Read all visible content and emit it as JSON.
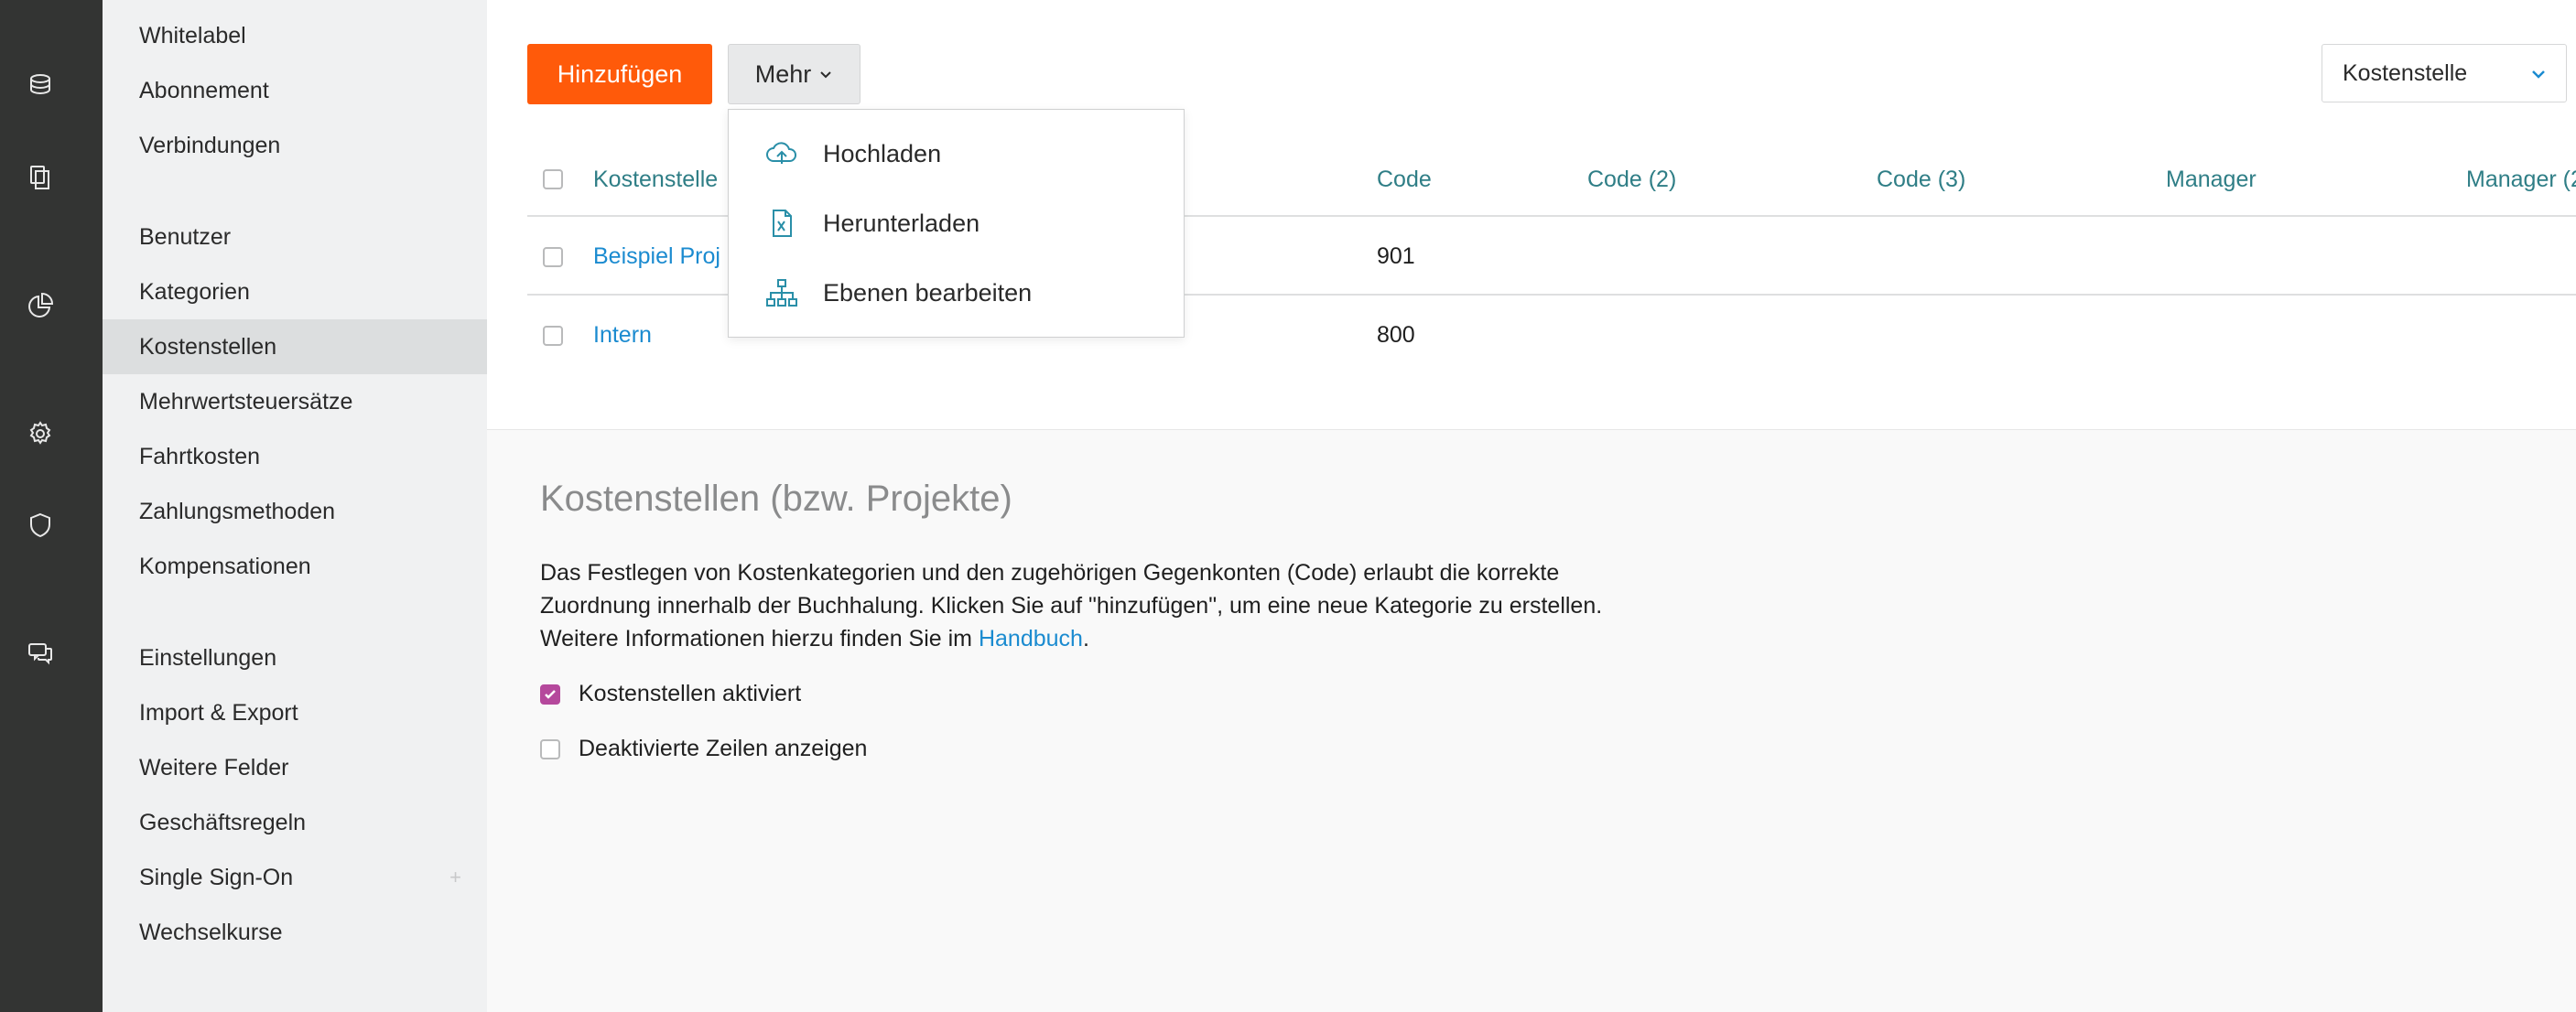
{
  "sidebar": {
    "items": [
      {
        "label": "Whitelabel"
      },
      {
        "label": "Abonnement"
      },
      {
        "label": "Verbindungen"
      },
      {
        "label": "Benutzer"
      },
      {
        "label": "Kategorien"
      },
      {
        "label": "Kostenstellen",
        "active": true
      },
      {
        "label": "Mehrwertsteuersätze"
      },
      {
        "label": "Fahrtkosten"
      },
      {
        "label": "Zahlungsmethoden"
      },
      {
        "label": "Kompensationen"
      },
      {
        "label": "Einstellungen"
      },
      {
        "label": "Import & Export"
      },
      {
        "label": "Weitere Felder"
      },
      {
        "label": "Geschäftsregeln"
      },
      {
        "label": "Single Sign-On",
        "extra": "+"
      },
      {
        "label": "Wechselkurse"
      }
    ]
  },
  "rail": {
    "icons": [
      "database-icon",
      "documents-icon",
      "pie-chart-icon",
      "gear-icon",
      "shield-icon",
      "chat-icon"
    ]
  },
  "toolbar": {
    "add_label": "Hinzufügen",
    "more_label": "Mehr",
    "selector_value": "Kostenstelle"
  },
  "dropdown": {
    "items": [
      {
        "label": "Hochladen",
        "icon": "cloud-upload-icon"
      },
      {
        "label": "Herunterladen",
        "icon": "excel-file-icon"
      },
      {
        "label": "Ebenen bearbeiten",
        "icon": "hierarchy-icon"
      }
    ]
  },
  "table": {
    "columns": [
      "Kostenstelle",
      "Code",
      "Code (2)",
      "Code (3)",
      "Manager",
      "Manager (2"
    ],
    "rows": [
      {
        "name": "Beispiel Proj",
        "code": "901"
      },
      {
        "name": "Intern",
        "code": "800"
      }
    ]
  },
  "info": {
    "title": "Kostenstellen (bzw. Projekte)",
    "description_1": "Das Festlegen von Kostenkategorien und den zugehörigen Gegenkonten (Code) erlaubt die korrekte",
    "description_2": "Zuordnung innerhalb der Buchhalung. Klicken Sie auf \"hinzufügen\", um eine neue Kategorie zu erstellen.",
    "description_3_pre": "Weitere Informationen hierzu finden Sie im ",
    "handbook_link": "Handbuch",
    "description_3_post": ".",
    "option_enabled_label": "Kostenstellen aktiviert",
    "option_enabled_checked": true,
    "option_show_disabled_label": "Deaktivierte Zeilen anzeigen",
    "option_show_disabled_checked": false
  },
  "colors": {
    "accent": "#ff5a0a",
    "link": "#1b8bd0",
    "header_teal": "#2f7e86",
    "checkbox_checked": "#b5489c",
    "rail_bg": "#333433"
  }
}
